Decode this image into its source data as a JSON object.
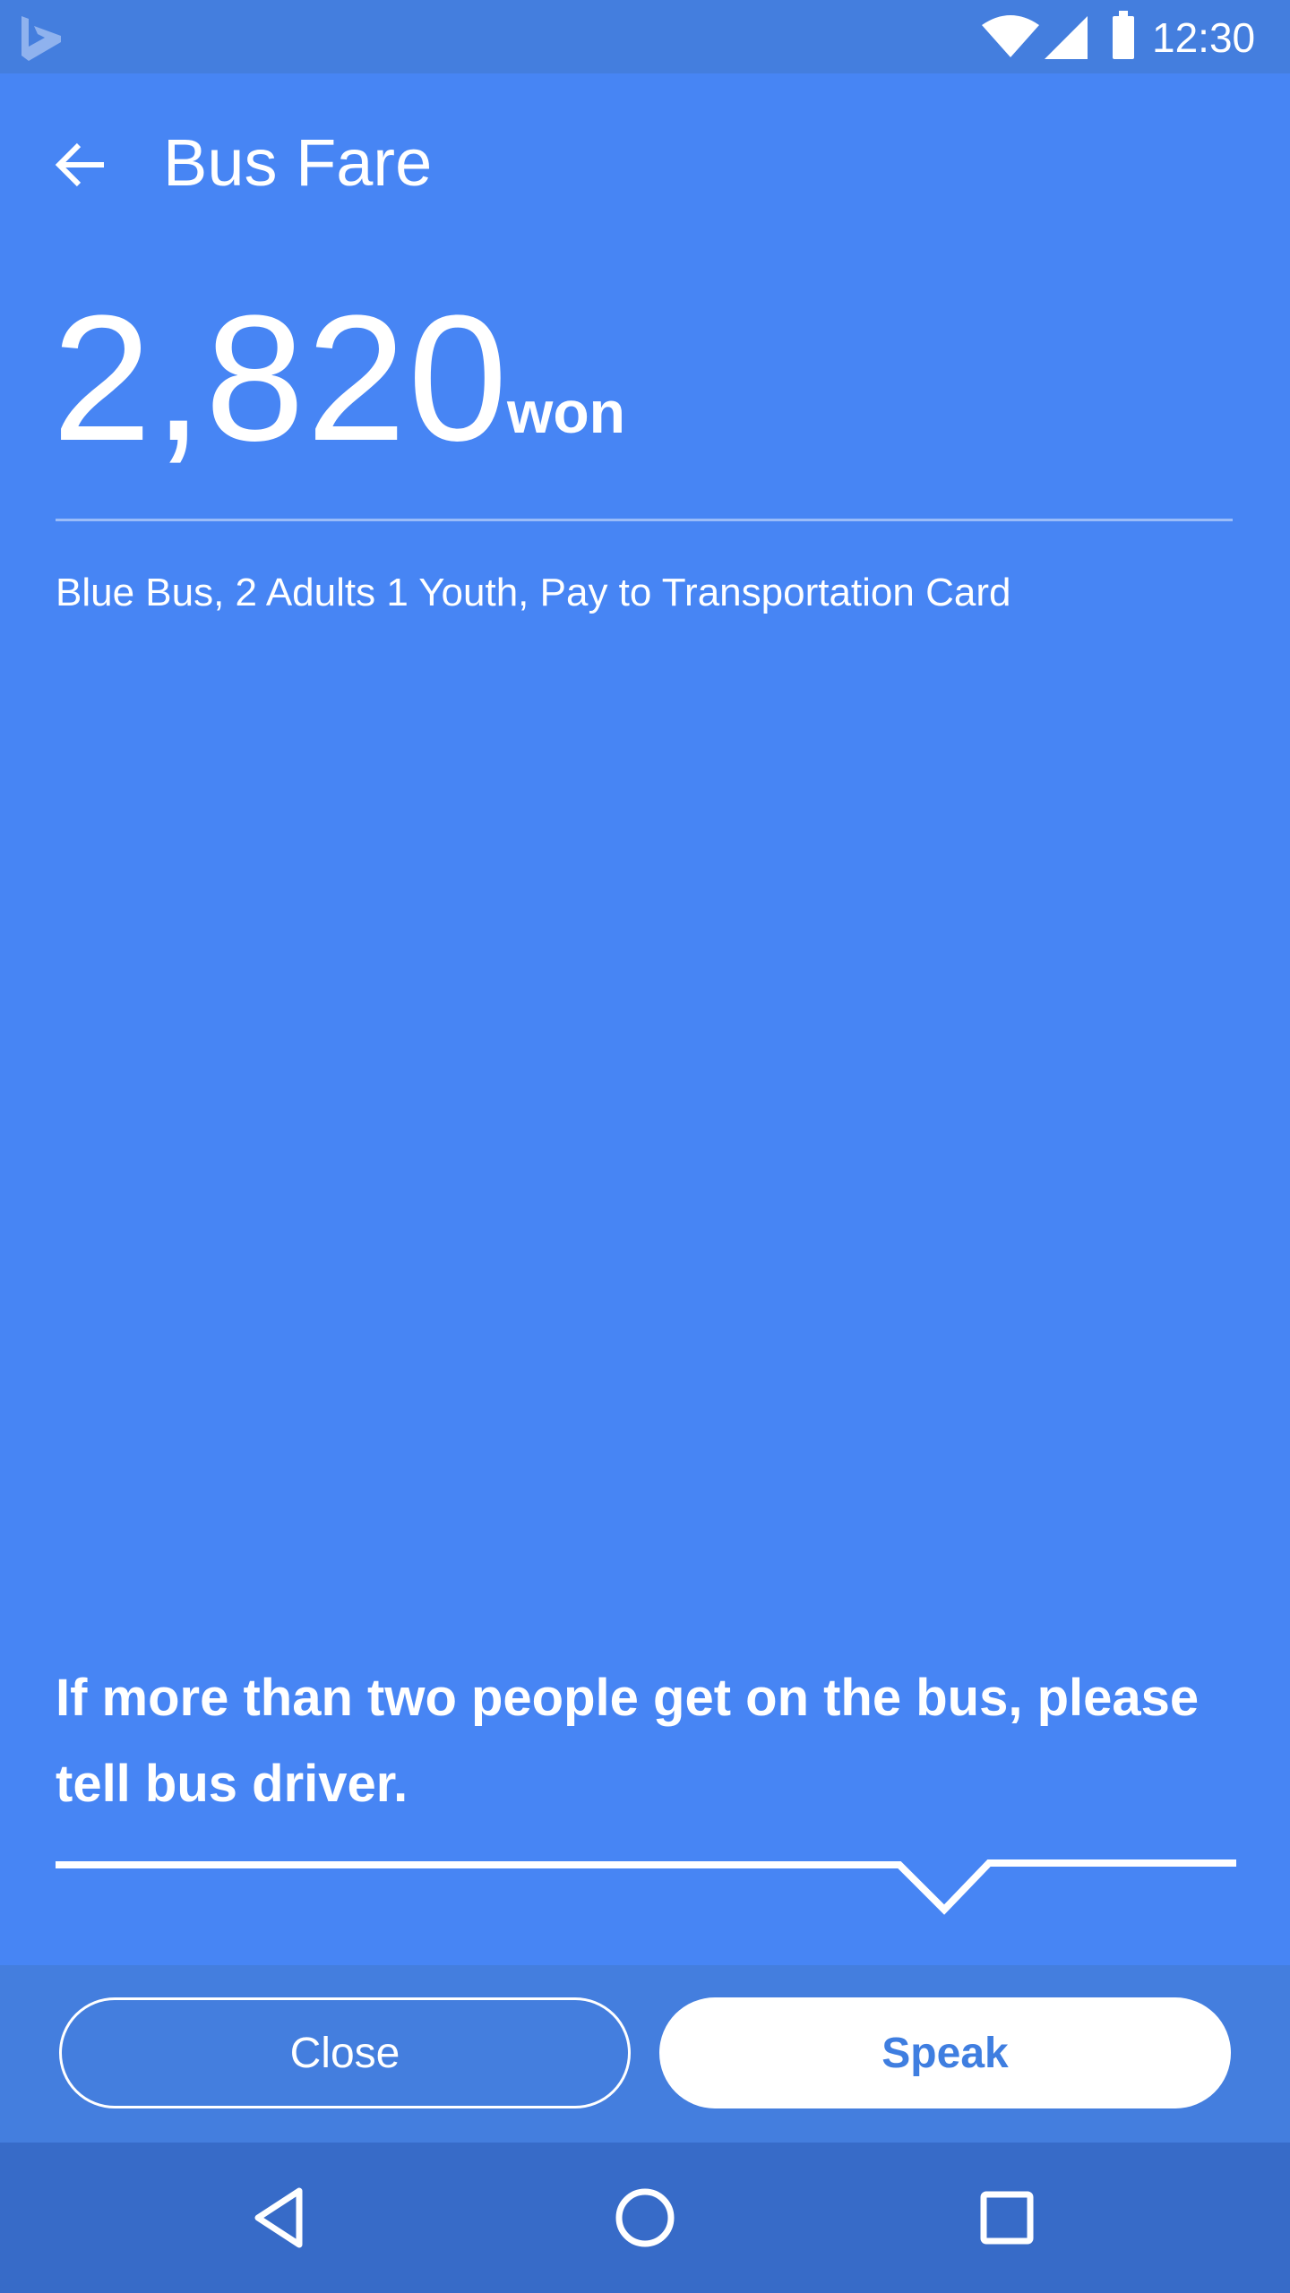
{
  "status_bar": {
    "time": "12:30",
    "icons": [
      "bing-logo-icon",
      "wifi-icon",
      "cellular-signal-icon",
      "battery-icon"
    ]
  },
  "header": {
    "title": "Bus Fare",
    "back_icon": "arrow-left-icon"
  },
  "fare": {
    "amount": "2,820",
    "unit": "won",
    "details": "Blue Bus, 2 Adults 1 Youth, Pay to Transportation Card"
  },
  "message": {
    "text": "If more than two people get on the bus, please tell bus driver."
  },
  "actions": {
    "close_label": "Close",
    "speak_label": "Speak"
  },
  "nav_bar": {
    "icons": [
      "nav-back-icon",
      "nav-home-icon",
      "nav-recents-icon"
    ]
  },
  "colors": {
    "background": "#4785f4",
    "status_bar": "#447ede",
    "action_bar": "#447ede",
    "nav_bar": "#376bc8",
    "speak_text": "#3f7ee0",
    "foreground": "#ffffff"
  }
}
